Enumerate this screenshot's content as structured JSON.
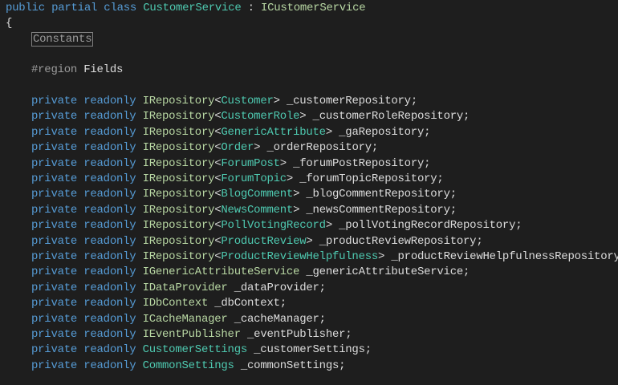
{
  "code": {
    "class_decl": {
      "public": "public",
      "partial": "partial",
      "class": "class",
      "name": "CustomerService",
      "colon": " : ",
      "base": "ICustomerService"
    },
    "open_brace": "{",
    "collapsed_region": "Constants",
    "region": {
      "directive": "#region",
      "name": "Fields"
    },
    "fields": [
      {
        "mods": "private readonly",
        "type": "IRepository",
        "generic": "Customer",
        "name": "_customerRepository;"
      },
      {
        "mods": "private readonly",
        "type": "IRepository",
        "generic": "CustomerRole",
        "name": "_customerRoleRepository;"
      },
      {
        "mods": "private readonly",
        "type": "IRepository",
        "generic": "GenericAttribute",
        "name": "_gaRepository;"
      },
      {
        "mods": "private readonly",
        "type": "IRepository",
        "generic": "Order",
        "name": "_orderRepository;"
      },
      {
        "mods": "private readonly",
        "type": "IRepository",
        "generic": "ForumPost",
        "name": "_forumPostRepository;"
      },
      {
        "mods": "private readonly",
        "type": "IRepository",
        "generic": "ForumTopic",
        "name": "_forumTopicRepository;"
      },
      {
        "mods": "private readonly",
        "type": "IRepository",
        "generic": "BlogComment",
        "name": "_blogCommentRepository;"
      },
      {
        "mods": "private readonly",
        "type": "IRepository",
        "generic": "NewsComment",
        "name": "_newsCommentRepository;"
      },
      {
        "mods": "private readonly",
        "type": "IRepository",
        "generic": "PollVotingRecord",
        "name": "_pollVotingRecordRepository;"
      },
      {
        "mods": "private readonly",
        "type": "IRepository",
        "generic": "ProductReview",
        "name": "_productReviewRepository;"
      },
      {
        "mods": "private readonly",
        "type": "IRepository",
        "generic": "ProductReviewHelpfulness",
        "name": "_productReviewHelpfulnessRepository;"
      },
      {
        "mods": "private readonly",
        "type": "IGenericAttributeService",
        "name": "_genericAttributeService;"
      },
      {
        "mods": "private readonly",
        "type": "IDataProvider",
        "name": "_dataProvider;"
      },
      {
        "mods": "private readonly",
        "type": "IDbContext",
        "name": "_dbContext;"
      },
      {
        "mods": "private readonly",
        "type": "ICacheManager",
        "name": "_cacheManager;"
      },
      {
        "mods": "private readonly",
        "type": "IEventPublisher",
        "name": "_eventPublisher;"
      },
      {
        "mods": "private readonly",
        "type": "CustomerSettings",
        "name": "_customerSettings;",
        "class_type": true
      },
      {
        "mods": "private readonly",
        "type": "CommonSettings",
        "name": "_commonSettings;",
        "class_type": true
      }
    ]
  },
  "colors": {
    "background": "#1e1e1e",
    "keyword": "#569cd6",
    "class_type": "#4ec9b0",
    "interface_type": "#b8d7a3",
    "plain_text": "#dcdcdc",
    "preprocessor": "#9b9b9b"
  }
}
